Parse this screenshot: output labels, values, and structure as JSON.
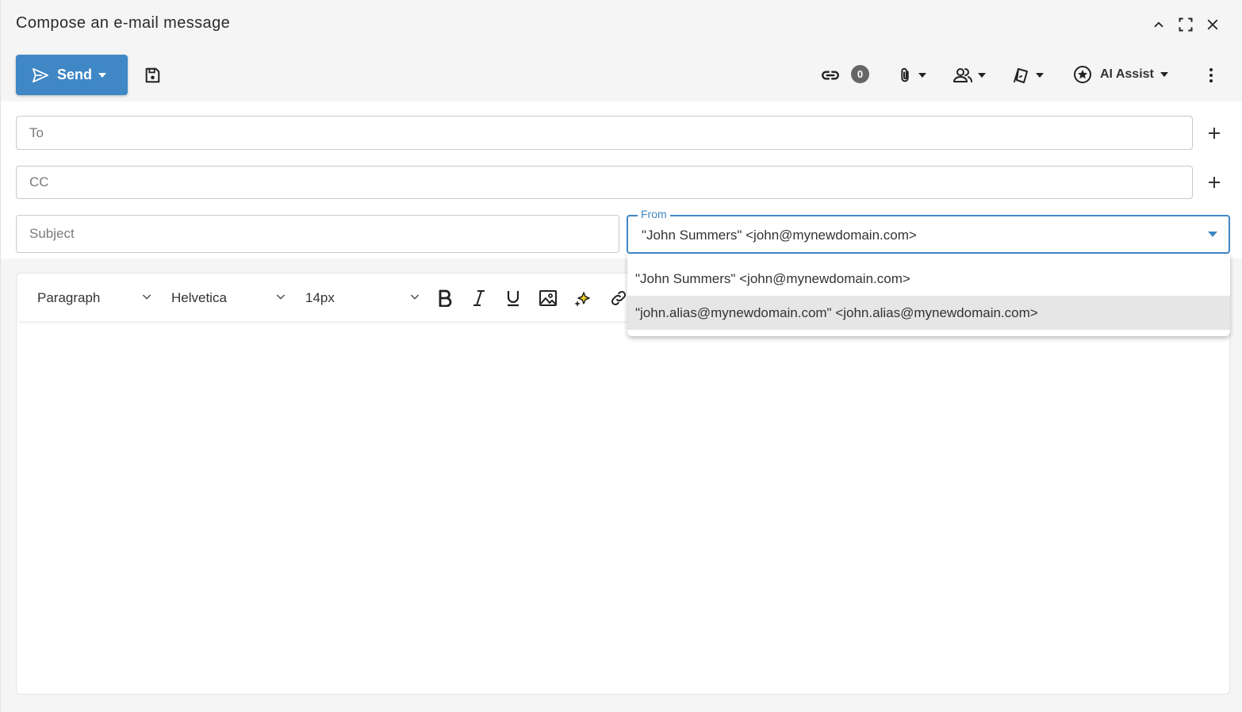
{
  "window": {
    "title": "Compose an e-mail message",
    "controls": [
      "chevron-up-icon",
      "fullscreen-icon",
      "close-icon"
    ]
  },
  "toolbar": {
    "send_label": "Send",
    "link_count": "0",
    "ai_assist_label": "AI Assist",
    "icons": [
      "send-icon",
      "save-icon",
      "link-icon",
      "paperclip-icon",
      "contacts-icon",
      "sign-icon",
      "ai-star-icon",
      "more-vertical-icon"
    ]
  },
  "form": {
    "to": {
      "placeholder": "To",
      "value": ""
    },
    "cc": {
      "placeholder": "CC",
      "value": ""
    },
    "subject": {
      "placeholder": "Subject",
      "value": ""
    },
    "from": {
      "label": "From",
      "value": "\"John Summers\" <john@mynewdomain.com>",
      "options": [
        "\"John Summers\" <john@mynewdomain.com>",
        "\"john.alias@mynewdomain.com\" <john.alias@mynewdomain.com>"
      ],
      "highlighted_index": 1
    }
  },
  "editor": {
    "block_format": "Paragraph",
    "font_family": "Helvetica",
    "font_size": "14px",
    "buttons": [
      "bold-icon",
      "italic-icon",
      "underline-icon",
      "image-icon",
      "sparkle-icon",
      "link-icon"
    ]
  },
  "colors": {
    "accent": "#3f87c5",
    "background": "#f5f5f5",
    "highlight": "#e6e6e6"
  }
}
